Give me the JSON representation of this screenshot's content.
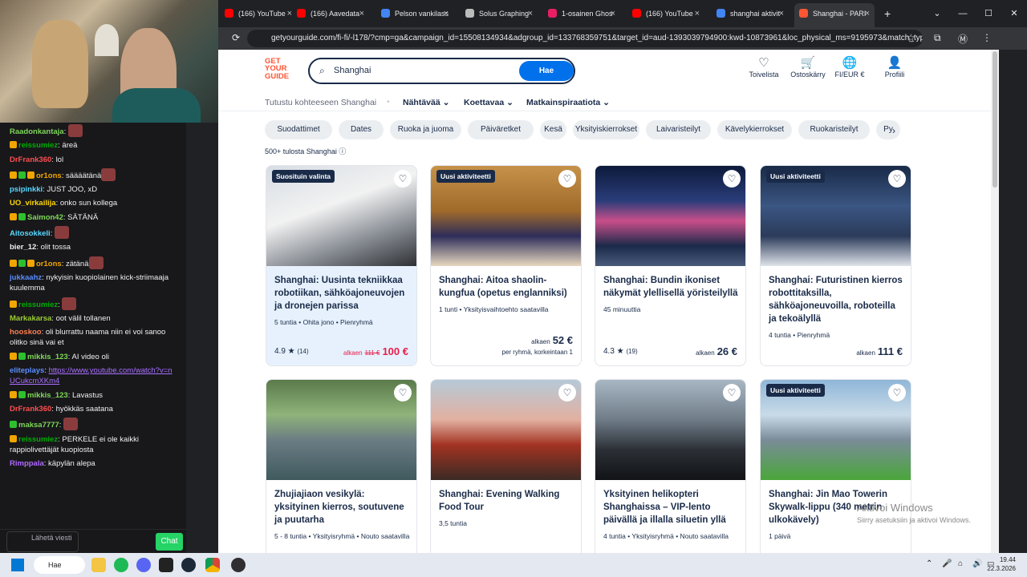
{
  "browser": {
    "tabs": [
      {
        "label": "(166) YouTube",
        "color": "#ff0000"
      },
      {
        "label": "(166) Aavedata",
        "color": "#ff0000"
      },
      {
        "label": "Pelson vankilass",
        "color": "#4285f4"
      },
      {
        "label": "Solus Graphing",
        "color": "#bbbbbb"
      },
      {
        "label": "1-osainen Ghos",
        "color": "#e91e63"
      },
      {
        "label": "(166) YouTube",
        "color": "#ff0000"
      },
      {
        "label": "shanghai aktivit",
        "color": "#4285f4"
      },
      {
        "label": "Shanghai - PARI",
        "color": "#ff5533"
      }
    ],
    "new_tab": "+",
    "url": "getyourguide.com/fi-fi/-l178/?cmp=ga&campaign_id=15508134934&adgroup_id=133768359751&target_id=aud-1393039794900:kwd-10873961&loc_physical_ms=9195973&match_type=...",
    "window_controls": [
      "⌄",
      "—",
      "☐",
      "✕"
    ]
  },
  "site": {
    "logo_lines": [
      "GET",
      "YOUR",
      "GUIDE"
    ],
    "search_value": "Shanghai",
    "search_button": "Hae",
    "header_actions": [
      {
        "label": "Toivelista",
        "icon": "heart-icon",
        "glyph": "♡"
      },
      {
        "label": "Ostoskärry",
        "icon": "cart-icon",
        "glyph": "🛒"
      },
      {
        "label": "FI/EUR €",
        "icon": "globe-icon",
        "glyph": "🌐"
      },
      {
        "label": "Profiili",
        "icon": "profile-icon",
        "glyph": "👤"
      }
    ],
    "subnav_intro": "Tutustu kohteeseen Shanghai",
    "subnav_menus": [
      "Nähtävää",
      "Koettavaa",
      "Matkainspiraatiota"
    ],
    "chips": [
      "Suodattimet",
      "Dates",
      "Ruoka ja juoma",
      "Päiväretket",
      "Kesä",
      "Yksityiskierrokset",
      "Laivaristeilyt",
      "Kävelykierrokset",
      "Ruokaristeilyt",
      "Py"
    ],
    "results_count": "500+ tulosta Shanghai",
    "cards": [
      {
        "badge": "Suosituin valinta",
        "title": "Shanghai: Uusinta tekniikkaa robotiikan, sähköajoneuvojen ja dronejen parissa",
        "meta": "5 tuntia • Ohita jono • Pienryhmä",
        "rating": "4.9",
        "reviews": "(14)",
        "price_prefix": "alkaen",
        "old_price": "111 €",
        "price": "100 €",
        "price_sub": "",
        "highlight": true,
        "img": "linear-gradient(160deg,#d7dde4 0%,#f2f2f2 40%,#8a8f96 70%,#2d2f33 100%)"
      },
      {
        "badge": "Uusi aktiviteetti",
        "title": "Shanghai: Aitoa shaolin-kungfua (opetus englanniksi)",
        "meta": "1 tunti • Yksityisvaihtoehto saatavilla",
        "rating": "",
        "reviews": "",
        "price_prefix": "alkaen",
        "old_price": "",
        "price": "52 €",
        "price_sub": "per ryhmä, korkeintaan 1",
        "highlight": false,
        "img": "linear-gradient(180deg,#c6924a 0%,#a06a2a 45%,#2e2d5a 70%,#e7d8bf 100%)"
      },
      {
        "badge": "",
        "title": "Shanghai: Bundin ikoniset näkymät ylellisellä yöristeilyllä",
        "meta": "45 minuuttia",
        "rating": "4.3",
        "reviews": "(19)",
        "price_prefix": "alkaen",
        "old_price": "",
        "price": "26 €",
        "price_sub": "",
        "highlight": false,
        "img": "linear-gradient(180deg,#0c1a3a 0%,#2a3d7a 35%,#c94f8a 55%,#1b2a4a 80%,#4a5b7a 100%)"
      },
      {
        "badge": "Uusi aktiviteetti",
        "title": "Shanghai: Futuristinen kierros robottitaksilla, sähköajoneuvoilla, roboteilla ja tekoälyllä",
        "meta": "4 tuntia • Pienryhmä",
        "rating": "",
        "reviews": "",
        "price_prefix": "alkaen",
        "old_price": "",
        "price": "111 €",
        "price_sub": "",
        "highlight": false,
        "img": "linear-gradient(180deg,#1a2a48 0%,#3b5683 40%,#2b3b5a 70%,#dfe3ea 100%)"
      },
      {
        "badge": "",
        "title": "Zhujiajiaon vesikylä: yksityinen kierros, soutuvene ja puutarha",
        "meta": "5 - 8 tuntia • Yksityisryhmä • Nouto saatavilla",
        "rating": "",
        "reviews": "",
        "price_prefix": "",
        "old_price": "",
        "price": "",
        "price_sub": "",
        "highlight": false,
        "img": "linear-gradient(180deg,#5a7a4a 0%,#8fb37a 35%,#6b7d84 60%,#3f5a5e 100%)"
      },
      {
        "badge": "",
        "title": "Shanghai: Evening Walking Food Tour",
        "meta": "3,5 tuntia",
        "rating": "",
        "reviews": "",
        "price_prefix": "",
        "old_price": "",
        "price": "",
        "price_sub": "",
        "highlight": false,
        "img": "linear-gradient(180deg,#b6c9d8 0%,#e2b0a0 40%,#a23322 65%,#3a2a24 100%)"
      },
      {
        "badge": "",
        "title": "Yksityinen helikopteri Shanghaissa – VIP-lento päivällä ja illalla siluetin yllä",
        "meta": "4 tuntia • Yksityisryhmä • Nouto saatavilla",
        "rating": "",
        "reviews": "",
        "price_prefix": "",
        "old_price": "",
        "price": "",
        "price_sub": "",
        "highlight": false,
        "img": "linear-gradient(180deg,#a9b7c4 0%,#6f7c88 40%,#2b2f35 70%,#111316 100%)"
      },
      {
        "badge": "Uusi aktiviteetti",
        "title": "Shanghai: Jin Mao Towerin Skywalk-lippu (340 metrin ulkokävely)",
        "meta": "1 päivä",
        "rating": "",
        "reviews": "",
        "price_prefix": "",
        "old_price": "",
        "price": "",
        "price_sub": "",
        "highlight": false,
        "img": "linear-gradient(180deg,#8fb6d8 0%,#c9dbe8 35%,#7a8c99 60%,#4aa63a 100%)"
      }
    ]
  },
  "watermark": {
    "title": "Aktivoi Windows",
    "sub": "Siirry asetuksiin ja aktivoi Windows."
  },
  "chat": {
    "messages": [
      {
        "user": "Raadonkantaja",
        "color": "#7fd858",
        "text": "",
        "badges": [],
        "emote": true
      },
      {
        "user": "reissumiez",
        "color": "#00ad03",
        "text": "äreä",
        "badges": [
          "#f0a500"
        ],
        "emote": false
      },
      {
        "user": "DrFrank360",
        "color": "#ff4f4f",
        "text": "lol",
        "badges": [],
        "emote": false
      },
      {
        "user": "or1ons",
        "color": "#f0a500",
        "text": "säääätänä",
        "badges": [
          "#f0a500",
          "#2ebf2e",
          "#f0a500"
        ],
        "emote": true
      },
      {
        "user": "psipinkki",
        "color": "#58d8ff",
        "text": "JUST JOO, xD",
        "badges": [],
        "emote": false
      },
      {
        "user": "UO_virkailija",
        "color": "#ffd700",
        "text": "onko sun kollega",
        "badges": [],
        "emote": false
      },
      {
        "user": "Saimon42",
        "color": "#7fd858",
        "text": "SÄTÄNÄ",
        "badges": [
          "#f0a500",
          "#2ebf2e"
        ],
        "emote": false
      },
      {
        "user": "Aitosokkeli",
        "color": "#58d8ff",
        "text": "",
        "badges": [],
        "emote": true
      },
      {
        "user": "bier_12",
        "color": "#efeff1",
        "text": "olit tossa",
        "badges": [],
        "emote": false
      },
      {
        "user": "or1ons",
        "color": "#f0a500",
        "text": "zätänä",
        "badges": [
          "#f0a500",
          "#2ebf2e",
          "#f0a500"
        ],
        "emote": true
      },
      {
        "user": "jukkaahz",
        "color": "#5a8dff",
        "text": "nykyisin kuopiolainen kick-striimaaja kuulemma",
        "badges": [],
        "emote": false
      },
      {
        "user": "reissumiez",
        "color": "#00ad03",
        "text": "",
        "badges": [
          "#f0a500"
        ],
        "emote": true
      },
      {
        "user": "Markakarsa",
        "color": "#9acd32",
        "text": "oot välil tollanen",
        "badges": [],
        "emote": false
      },
      {
        "user": "hooskoo",
        "color": "#ff7f50",
        "text": "oli blurrattu naama niin ei voi sanoo olitko sinä vai et",
        "badges": [],
        "emote": false
      },
      {
        "user": "mikkis_123",
        "color": "#7fd858",
        "text": "AI video oli",
        "badges": [
          "#f0a500",
          "#2ebf2e"
        ],
        "emote": false
      },
      {
        "user": "eliteplays",
        "color": "#5a8dff",
        "text": "https://www.youtube.com/watch?v=nUCukcmXKm4",
        "badges": [],
        "emote": false,
        "link": true
      },
      {
        "user": "mikkis_123",
        "color": "#7fd858",
        "text": "Lavastus",
        "badges": [
          "#f0a500",
          "#2ebf2e"
        ],
        "emote": false
      },
      {
        "user": "DrFrank360",
        "color": "#ff4f4f",
        "text": "hyökkäs saatana",
        "badges": [],
        "emote": false
      },
      {
        "user": "maksa7777",
        "color": "#7fd858",
        "text": "",
        "badges": [
          "#2ebf2e"
        ],
        "emote": true
      },
      {
        "user": "reissumiez",
        "color": "#00ad03",
        "text": "PERKELE ei ole kaikki rappiolivettäjät kuopiosta",
        "badges": [
          "#f0a500"
        ],
        "emote": false
      },
      {
        "user": "Rimppala",
        "color": "#b069ff",
        "text": "käpylän alepa",
        "badges": [],
        "emote": false
      }
    ],
    "input_placeholder": "Lähetä viesti",
    "chat_button": "Chat"
  },
  "taskbar": {
    "search": "Hae",
    "time": "19.44",
    "date": "22.3.2026"
  }
}
